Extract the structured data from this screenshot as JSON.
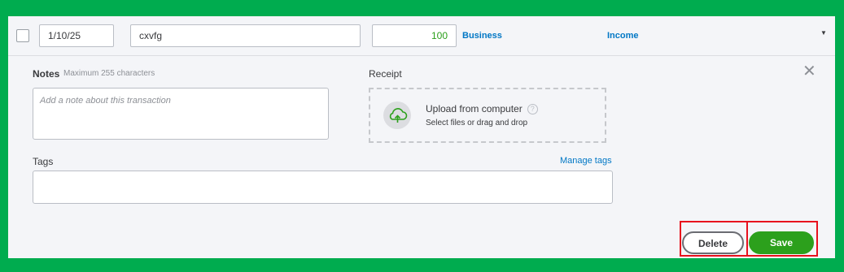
{
  "row": {
    "date": "1/10/25",
    "description": "cxvfg",
    "amount": "100",
    "category": "Business",
    "type": "Income"
  },
  "notes": {
    "label": "Notes",
    "hint": "Maximum 255 characters",
    "placeholder": "Add a note about this transaction"
  },
  "receipt": {
    "label": "Receipt",
    "upload_title": "Upload from computer",
    "upload_sub": "Select files or drag and drop",
    "help_glyph": "?"
  },
  "tags": {
    "label": "Tags",
    "manage_link": "Manage tags"
  },
  "icons": {
    "close": "✕",
    "caret": "▼"
  },
  "actions": {
    "delete_label": "Delete",
    "save_label": "Save"
  },
  "colors": {
    "background_green": "#00ac4f",
    "accent_green": "#2ca01c",
    "link_blue": "#0077c5",
    "highlight_red": "#e8101d"
  }
}
